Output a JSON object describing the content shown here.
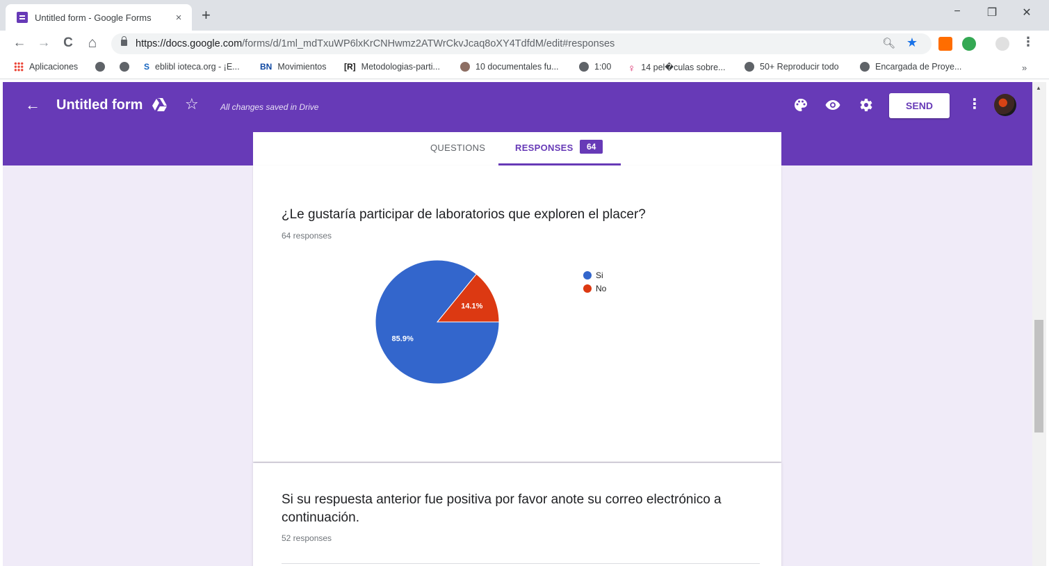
{
  "browser": {
    "tab_title": "Untitled form - Google Forms",
    "tab_close": "×",
    "new_tab": "+",
    "window_controls": [
      "−",
      "❐",
      "✕"
    ],
    "url_host": "https://docs.google.com",
    "url_path": "/forms/d/1ml_mdTxuWP6lxKrCNHwmz2ATWrCkvJcaq8oXY4TdfdM/edit#responses",
    "nav": {
      "back": "←",
      "forward": "→",
      "reload": "C",
      "home": "⌂"
    },
    "bookmarks": [
      {
        "label": "Aplicaciones",
        "icon": "apps-grid-icon"
      },
      {
        "label": "",
        "icon": "globe-icon"
      },
      {
        "label": "",
        "icon": "globe-icon"
      },
      {
        "label": "eblibl ioteca.org - ¡E...",
        "icon": "s-icon"
      },
      {
        "label": "Movimientos",
        "icon": "bn-icon"
      },
      {
        "label": "Metodologias-parti...",
        "icon": "r-icon"
      },
      {
        "label": "10 documentales fu...",
        "icon": "person-icon"
      },
      {
        "label": "1:00",
        "icon": "globe-icon"
      },
      {
        "label": "14 pel�culas sobre...",
        "icon": "female-icon"
      },
      {
        "label": "50+ Reproducir todo",
        "icon": "globe-icon"
      },
      {
        "label": "Encargada de Proye...",
        "icon": "globe-icon"
      }
    ],
    "bookmarks_more": "»"
  },
  "header": {
    "title": "Untitled form",
    "saved_status": "All changes saved in Drive",
    "send_label": "SEND",
    "brand_color": "#673ab7"
  },
  "tabs": {
    "questions_label": "QUESTIONS",
    "responses_label": "RESPONSES",
    "responses_count": "64"
  },
  "questions": [
    {
      "title": "¿Le gustaría participar de laboratorios que exploren el placer?",
      "responses": "64 responses"
    },
    {
      "title": "Si su respuesta anterior fue positiva por favor anote su correo electrónico a continuación.",
      "responses": "52 responses"
    }
  ],
  "chart_data": {
    "type": "pie",
    "categories": [
      "Si",
      "No"
    ],
    "values": [
      85.9,
      14.1
    ],
    "labels": [
      "85.9%",
      "14.1%"
    ],
    "colors": [
      "#3366cc",
      "#dc3912"
    ],
    "legend_position": "right"
  }
}
